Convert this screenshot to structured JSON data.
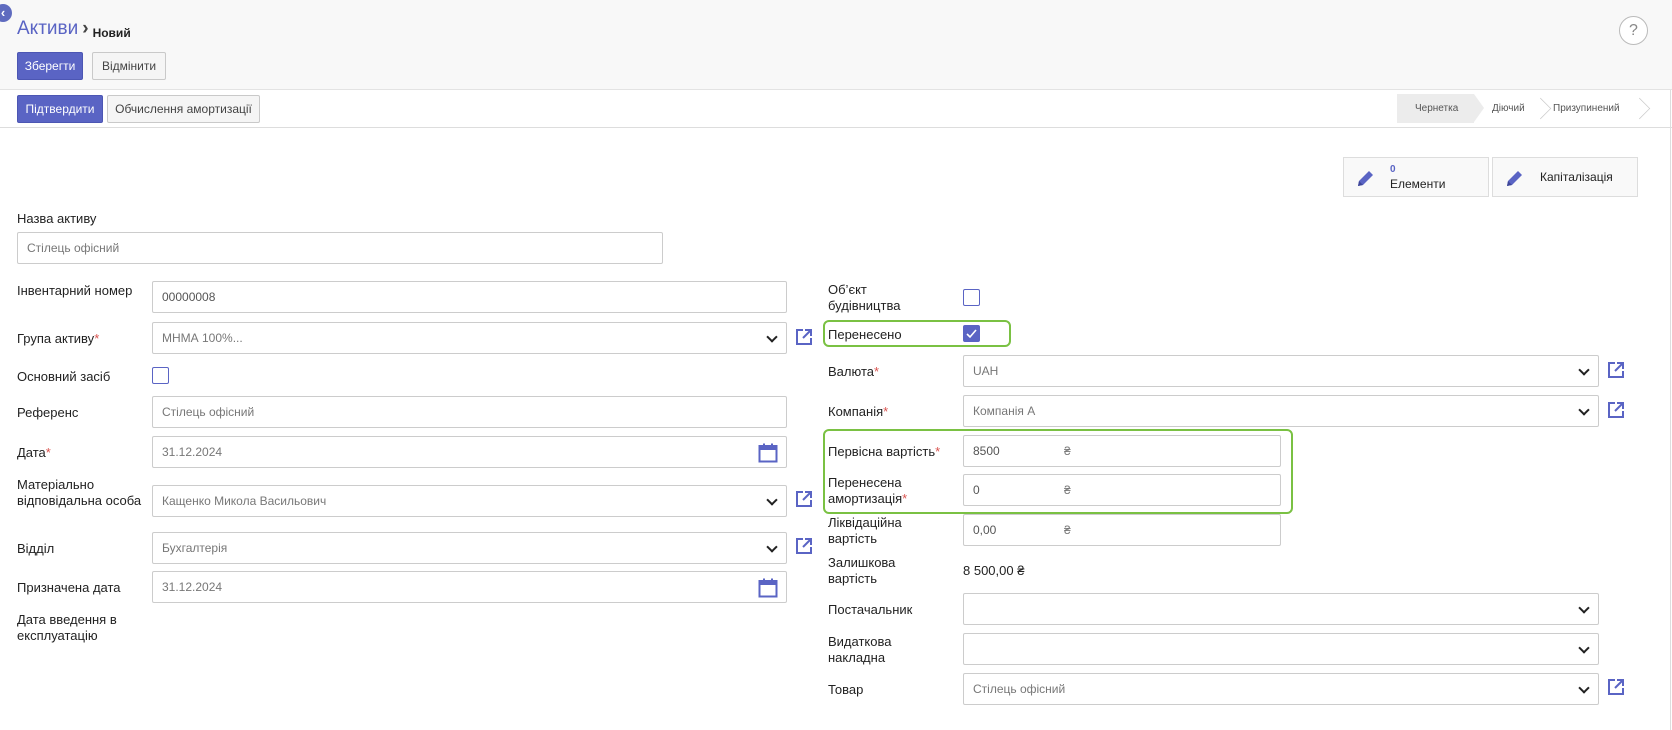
{
  "breadcrumb": {
    "parent": "Активи",
    "current": "Новий"
  },
  "toolbar": {
    "save_label": "Зберегти",
    "discard_label": "Відмінити",
    "help": "?"
  },
  "actions": {
    "confirm_label": "Підтвердити",
    "compute_label": "Обчислення амортизації"
  },
  "statusbar": {
    "stages": [
      "Чернетка",
      "Діючий",
      "Призупинений"
    ],
    "active": "Чернетка"
  },
  "smart_buttons": {
    "elements_count": "0",
    "elements_label": "Елементи",
    "capitalization_label": "Капіталізація"
  },
  "form": {
    "name_label": "Назва активу",
    "name_value": "Стілець офісний",
    "inventory_label": "Інвентарний номер",
    "inventory_value": "00000008",
    "group_label": "Група активу",
    "group_value": "МНМА 100%...",
    "fixed_asset_label": "Основний засіб",
    "reference_label": "Референс",
    "reference_value": "Стілець офісний",
    "date_label": "Дата",
    "date_value": "31.12.2024",
    "responsible_label": "Матеріально відповідальна особа",
    "responsible_value": "Кащенко Микола Васильович",
    "department_label": "Відділ",
    "department_value": "Бухгалтерія",
    "assigned_date_label": "Призначена дата",
    "assigned_date_value": "31.12.2024",
    "commissioning_label": "Дата введення в експлуатацію",
    "construction_label": "Об’єкт будівництва",
    "transferred_label": "Перенесено",
    "currency_label": "Валюта",
    "currency_value": "UAH",
    "company_label": "Компанія",
    "company_value": "Компанія А",
    "original_value_label": "Первісна вартість",
    "original_value": "8500",
    "transferred_depr_label": "Перенесена амортизація",
    "transferred_depr_value": "0",
    "salvage_label": "Ліквідаційна вартість",
    "salvage_value": "0,00",
    "residual_label": "Залишкова вартість",
    "residual_value": "8 500,00 ₴",
    "vendor_label": "Постачальник",
    "vendor_value": "",
    "invoice_label": "Видаткова накладна",
    "invoice_value": "",
    "product_label": "Товар",
    "product_value": "Стілець офісний",
    "currency_symbol": "₴"
  },
  "checks": {
    "fixed_asset": false,
    "construction": false,
    "transferred": true
  },
  "colors": {
    "accent": "#5a64c4",
    "highlight": "#7ac143",
    "required": "#d9534f"
  }
}
